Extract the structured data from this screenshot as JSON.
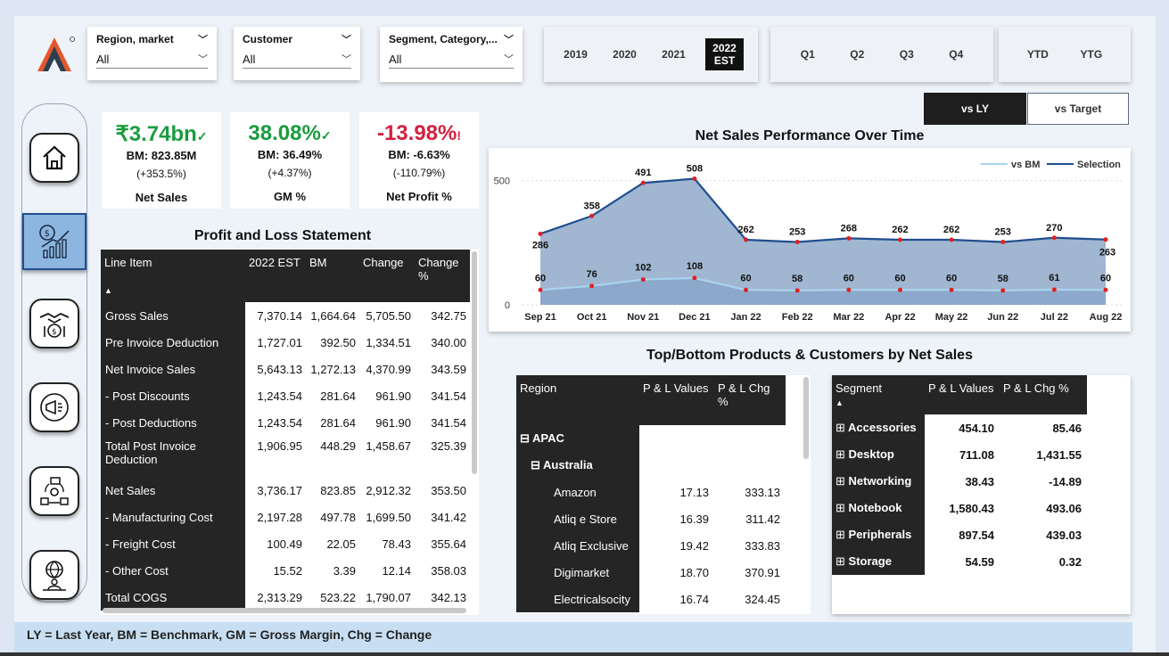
{
  "filters": [
    {
      "label": "Region, market",
      "value": "All"
    },
    {
      "label": "Customer",
      "value": "All"
    },
    {
      "label": "Segment, Category,...",
      "value": "All"
    }
  ],
  "years": [
    "2019",
    "2020",
    "2021"
  ],
  "year_active_1": "2022",
  "year_active_2": "EST",
  "quarters": [
    "Q1",
    "Q2",
    "Q3",
    "Q4"
  ],
  "ytd": [
    "YTD",
    "YTG"
  ],
  "compare": {
    "active": "vs LY",
    "other": "vs Target"
  },
  "kpis": [
    {
      "value": "₹3.74bn",
      "mark": "✓",
      "bm": "BM: 823.85M",
      "chg": "(+353.5%)",
      "label": "Net Sales",
      "color": "#1a9c3e"
    },
    {
      "value": "38.08%",
      "mark": "✓",
      "bm": "BM: 36.49%",
      "chg": "(+4.37%)",
      "label": "GM %",
      "color": "#1a9c3e"
    },
    {
      "value": "-13.98%",
      "mark": "!",
      "bm": "BM: -6.63%",
      "chg": "(-110.79%)",
      "label": "Net Profit %",
      "color": "#d4213d"
    }
  ],
  "pl": {
    "title": "Profit and Loss Statement",
    "headers": [
      "Line Item",
      "2022 EST",
      "BM",
      "Change",
      "Change %"
    ],
    "sort_mark": "▲",
    "rows": [
      [
        "Gross Sales",
        "7,370.14",
        "1,664.64",
        "5,705.50",
        "342.75"
      ],
      [
        "Pre Invoice Deduction",
        "1,727.01",
        "392.50",
        "1,334.51",
        "340.00"
      ],
      [
        "Net Invoice Sales",
        "5,643.13",
        "1,272.13",
        "4,370.99",
        "343.59"
      ],
      [
        "- Post Discounts",
        "1,243.54",
        "281.64",
        "961.90",
        "341.54"
      ],
      [
        "- Post Deductions",
        "1,243.54",
        "281.64",
        "961.90",
        "341.54"
      ],
      [
        "Total Post Invoice Deduction",
        "1,906.95",
        "448.29",
        "1,458.67",
        "325.39"
      ],
      [
        "Net Sales",
        "3,736.17",
        "823.85",
        "2,912.32",
        "353.50"
      ],
      [
        "- Manufacturing Cost",
        "2,197.28",
        "497.78",
        "1,699.50",
        "341.42"
      ],
      [
        "- Freight Cost",
        "100.49",
        "22.05",
        "78.43",
        "355.64"
      ],
      [
        "- Other Cost",
        "15.52",
        "3.39",
        "12.14",
        "358.03"
      ],
      [
        "Total COGS",
        "2,313.29",
        "523.22",
        "1,790.07",
        "342.13"
      ]
    ]
  },
  "chart_title": "Net Sales Performance Over Time",
  "chart_data": {
    "type": "area",
    "categories": [
      "Sep 21",
      "Oct 21",
      "Nov 21",
      "Dec 21",
      "Jan 22",
      "Feb 22",
      "Mar 22",
      "Apr 22",
      "May 22",
      "Jun 22",
      "Jul 22",
      "Aug 22"
    ],
    "series": [
      {
        "name": "Selection",
        "values": [
          286,
          358,
          491,
          508,
          262,
          253,
          268,
          262,
          262,
          253,
          270,
          263
        ],
        "color": "#1f4f8f"
      },
      {
        "name": "vs BM",
        "values": [
          60,
          76,
          102,
          108,
          60,
          58,
          60,
          60,
          60,
          58,
          61,
          60
        ],
        "color": "#a9d3ef"
      }
    ],
    "y_ticks": [
      "0",
      "500"
    ],
    "ylim": [
      0,
      560
    ],
    "legend": "top-right"
  },
  "topbottom_title": "Top/Bottom Products & Customers by Net Sales",
  "region_table": {
    "headers": [
      "Region",
      "P & L Values",
      "P & L Chg %"
    ],
    "expand_icon": "⊟",
    "level1": "APAC",
    "level2": "Australia",
    "rows": [
      [
        "Amazon",
        "17.13",
        "333.13"
      ],
      [
        "Atliq e Store",
        "16.39",
        "311.42"
      ],
      [
        "Atliq Exclusive",
        "19.42",
        "333.83"
      ],
      [
        "Digimarket",
        "18.70",
        "370.91"
      ],
      [
        "Electricalsocity",
        "16.74",
        "324.45"
      ]
    ]
  },
  "segment_table": {
    "headers": [
      "Segment",
      "P & L Values",
      "P & L Chg %"
    ],
    "sort_mark": "▲",
    "expand_icon": "⊞",
    "rows": [
      [
        "Accessories",
        "454.10",
        "85.46"
      ],
      [
        "Desktop",
        "711.08",
        "1,431.55"
      ],
      [
        "Networking",
        "38.43",
        "-14.89"
      ],
      [
        "Notebook",
        "1,580.43",
        "493.06"
      ],
      [
        "Peripherals",
        "897.54",
        "439.03"
      ],
      [
        "Storage",
        "54.59",
        "0.32"
      ]
    ]
  },
  "footer": "LY = Last Year, BM = Benchmark, GM = Gross Margin,  Chg = Change"
}
